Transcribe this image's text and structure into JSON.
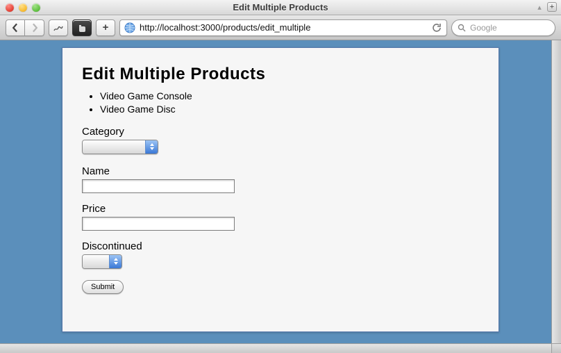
{
  "window": {
    "title": "Edit Multiple Products"
  },
  "toolbar": {
    "url": "http://localhost:3000/products/edit_multiple",
    "search_placeholder": "Google"
  },
  "page": {
    "heading": "Edit Multiple Products",
    "products": [
      "Video Game Console",
      "Video Game Disc"
    ],
    "fields": {
      "category": {
        "label": "Category",
        "selected": ""
      },
      "name": {
        "label": "Name",
        "value": ""
      },
      "price": {
        "label": "Price",
        "value": ""
      },
      "discontinued": {
        "label": "Discontinued",
        "selected": ""
      }
    },
    "submit_label": "Submit"
  }
}
